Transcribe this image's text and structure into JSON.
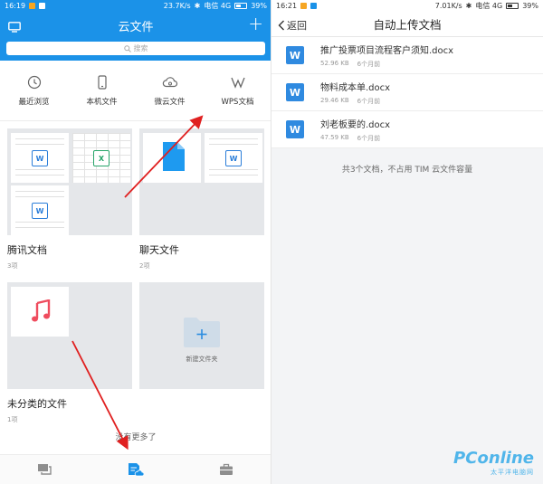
{
  "left": {
    "status": {
      "time": "16:19",
      "speed": "23.7K/s",
      "carrier": "电信 4G",
      "battery": "39%"
    },
    "title": "云文件",
    "search_placeholder": "搜索",
    "shortcuts": [
      {
        "label": "最近浏览",
        "icon": "clock-icon"
      },
      {
        "label": "本机文件",
        "icon": "phone-icon"
      },
      {
        "label": "微云文件",
        "icon": "cloud-icon"
      },
      {
        "label": "WPS文档",
        "icon": "wps-icon"
      }
    ],
    "folders": [
      {
        "name": "腾讯文档",
        "count": "3项"
      },
      {
        "name": "聊天文件",
        "count": "2项"
      },
      {
        "name": "未分类的文件",
        "count": "1项"
      },
      {
        "new_label": "新建文件夹"
      }
    ],
    "footer_text": "没有更多了",
    "nav": [
      "chat-icon",
      "cloud-files-icon",
      "briefcase-icon"
    ]
  },
  "right": {
    "status": {
      "time": "16:21",
      "speed": "7.01K/s",
      "carrier": "电信 4G",
      "battery": "39%"
    },
    "back_label": "返回",
    "title": "自动上传文档",
    "files": [
      {
        "name": "推广投票项目流程客户须知.docx",
        "size": "52.96 KB",
        "age": "6个月前"
      },
      {
        "name": "物料成本单.docx",
        "size": "29.46 KB",
        "age": "6个月前"
      },
      {
        "name": "刘老板要的.docx",
        "size": "47.59 KB",
        "age": "6个月前"
      }
    ],
    "summary": "共3个文档，不占用 TIM 云文件容量"
  },
  "watermark": {
    "brand": "PConline",
    "sub": "太平洋电脑网"
  },
  "colors": {
    "accent": "#1b92e8",
    "arrow": "#e02020",
    "word": "#2b7ed9"
  }
}
